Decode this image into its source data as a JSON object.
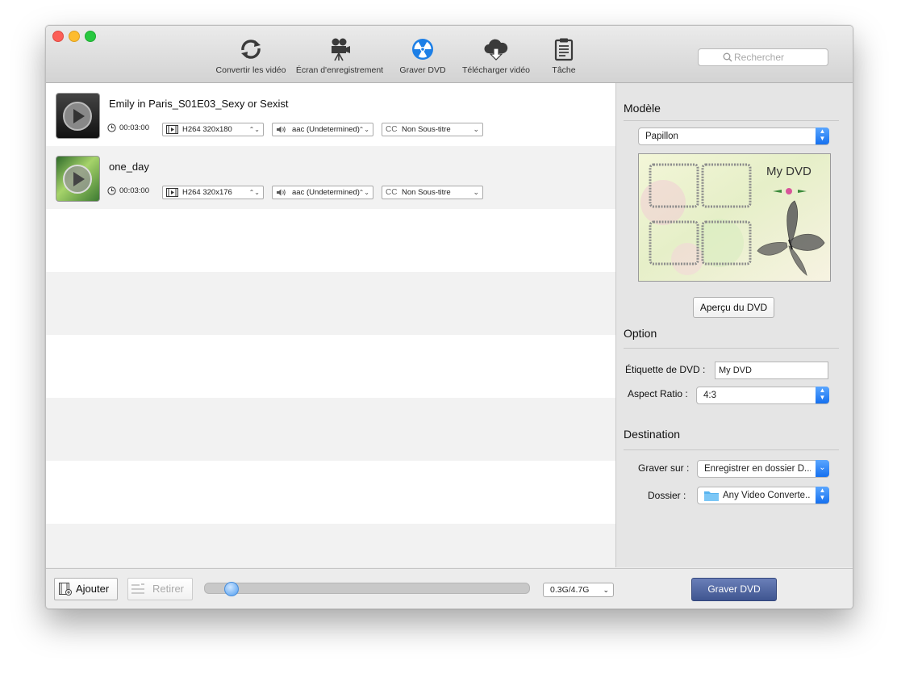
{
  "toolbar": {
    "items": [
      {
        "label": "Convertir les vidéo",
        "icon": "convert-refresh-icon"
      },
      {
        "label": "Écran d'enregistrement",
        "icon": "camera-icon"
      },
      {
        "label": "Graver DVD",
        "icon": "disc-radiation-icon"
      },
      {
        "label": "Télécharger vidéo",
        "icon": "cloud-download-icon"
      },
      {
        "label": "Tâche",
        "icon": "clipboard-icon"
      }
    ],
    "search_placeholder": "Rechercher"
  },
  "files": [
    {
      "name": "Emily in Paris_S01E03_Sexy or Sexist",
      "duration": "00:03:00",
      "video": "H264 320x180",
      "audio": "aac (Undetermined)",
      "subtitle": "Non Sous-titre"
    },
    {
      "name": "one_day",
      "duration": "00:03:00",
      "video": "H264 320x176",
      "audio": "aac (Undetermined)",
      "subtitle": "Non Sous-titre"
    }
  ],
  "sidebar": {
    "model_title": "Modèle",
    "template": "Papillon",
    "preview_title": "My DVD",
    "preview_button": "Aperçu du DVD",
    "option_title": "Option",
    "dvd_label_label": "Étiquette de DVD :",
    "dvd_label_value": "My DVD",
    "aspect_label": "Aspect Ratio :",
    "aspect_value": "4:3",
    "destination_title": "Destination",
    "burn_to_label": "Graver sur :",
    "burn_to_value": "Enregistrer en dossier D...",
    "folder_label": "Dossier  :",
    "folder_value": "Any Video Converte..."
  },
  "bottom": {
    "add_label": "Ajouter",
    "remove_label": "Retirer",
    "progress_fraction": 0.064,
    "size_value": "0.3G/4.7G",
    "burn_label": "Graver DVD"
  },
  "colors": {
    "accent": "#1570ef",
    "burn_button": "#4a5f9a"
  }
}
